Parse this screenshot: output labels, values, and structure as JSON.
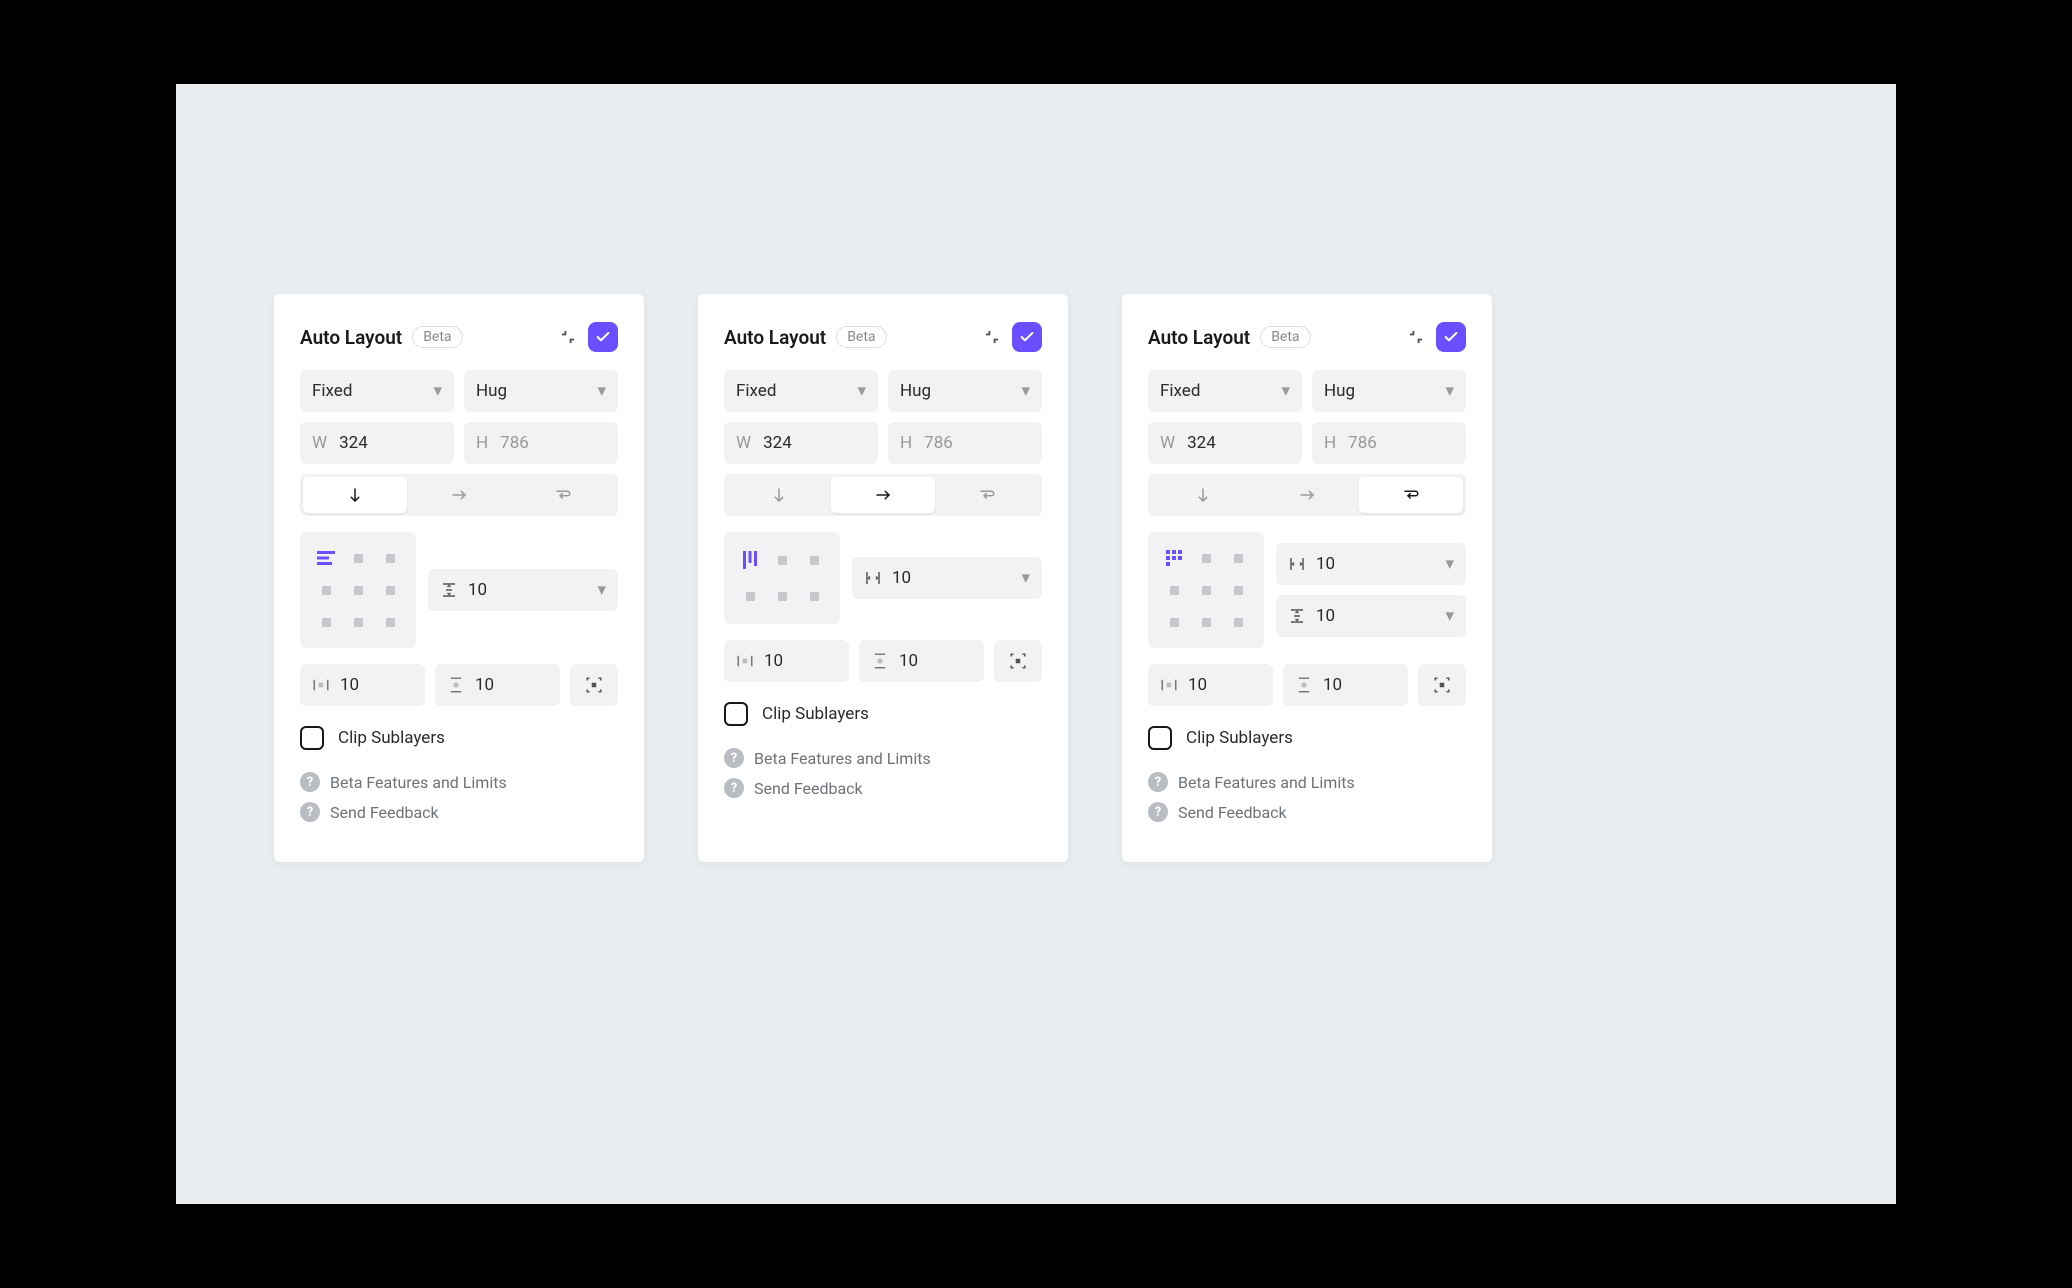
{
  "shared": {
    "title": "Auto Layout",
    "badge": "Beta",
    "width_mode": "Fixed",
    "height_mode": "Hug",
    "width_label": "W",
    "height_label": "H",
    "width_value": "324",
    "height_value": "786",
    "gap_value": "10",
    "gap_h_value": "10",
    "gap_v_value": "10",
    "pad_h_value": "10",
    "pad_v_value": "10",
    "clip_label": "Clip Sublayers",
    "link_beta": "Beta Features and Limits",
    "link_feedback": "Send Feedback"
  },
  "panels": [
    {
      "dir": "vertical"
    },
    {
      "dir": "horizontal"
    },
    {
      "dir": "wrap"
    }
  ]
}
